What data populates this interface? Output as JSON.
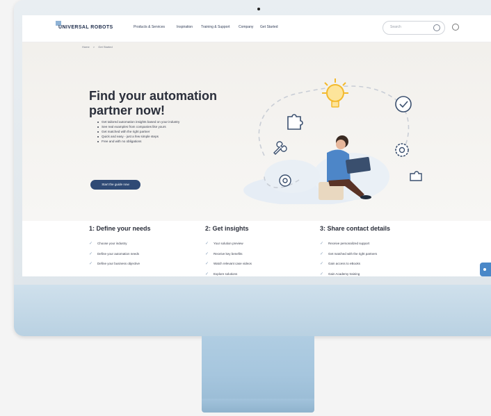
{
  "brand": {
    "name": "UNIVERSAL ROBOTS",
    "accent": "#2f4a75",
    "mark_color": "#8fb3d6"
  },
  "nav": {
    "items": [
      "Products & Services",
      "Inspiration",
      "Training & Support",
      "Company",
      "Get Started"
    ],
    "search_placeholder": "Search"
  },
  "breadcrumb": [
    "Home",
    ">",
    "Get Started"
  ],
  "hero": {
    "title": "Find your automation partner now!",
    "bullets": [
      "Get tailored automation insights based on your industry",
      "See real examples from companies like yours",
      "Get matched with the right partner",
      "Quick and easy - just a few simple steps",
      "Free and with no obligations"
    ],
    "cta_label": "Start the guide now"
  },
  "steps": [
    {
      "title": "1: Define your needs",
      "items": [
        "Choose your industry",
        "Define your automation needs",
        "Define your business objective"
      ]
    },
    {
      "title": "2: Get insights",
      "items": [
        "Your solution preview",
        "Receive key benefits",
        "Watch relevant case videos",
        "Explore solutions"
      ]
    },
    {
      "title": "3: Share contact details",
      "items": [
        "Receive personalized support",
        "Get matched with the right partners",
        "Gain access to eBooks",
        "Gain Academy training"
      ]
    }
  ],
  "icons": [
    "search-icon",
    "globe-icon",
    "lightbulb-icon",
    "puzzle-icon",
    "shield-check-icon",
    "wrench-icon",
    "gear-icon",
    "location-icon",
    "chat-icon"
  ]
}
